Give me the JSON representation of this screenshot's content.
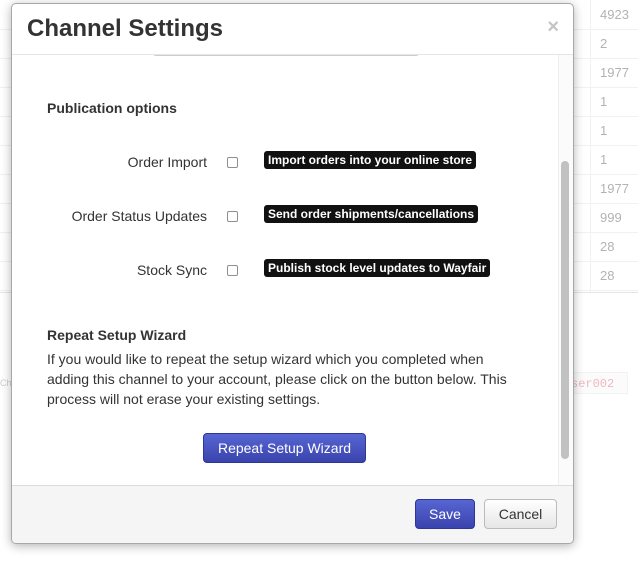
{
  "background": {
    "table_values": [
      "4923",
      "2",
      "1977",
      "1",
      "1",
      "1",
      "1977",
      "999",
      "28",
      "28"
    ],
    "left_fragment": "Cha",
    "code_fragment": "ser002"
  },
  "modal": {
    "title": "Channel Settings",
    "close_symbol": "×",
    "publication": {
      "heading": "Publication options",
      "options": [
        {
          "label": "Order Import",
          "checked": false,
          "tooltip": "Import orders into your online store"
        },
        {
          "label": "Order Status Updates",
          "checked": false,
          "tooltip": "Send order shipments/cancellations"
        },
        {
          "label": "Stock Sync",
          "checked": false,
          "tooltip": "Publish stock level updates to Wayfair"
        }
      ]
    },
    "wizard": {
      "heading": "Repeat Setup Wizard",
      "description": "If you would like to repeat the setup wizard which you completed when adding this channel to your account, please click on the button below. This process will not erase your existing settings.",
      "button_label": "Repeat Setup Wizard"
    },
    "footer": {
      "save_label": "Save",
      "cancel_label": "Cancel"
    }
  },
  "colors": {
    "primary_button": "#4450c4",
    "tooltip_bg": "#111111",
    "text": "#333333"
  }
}
